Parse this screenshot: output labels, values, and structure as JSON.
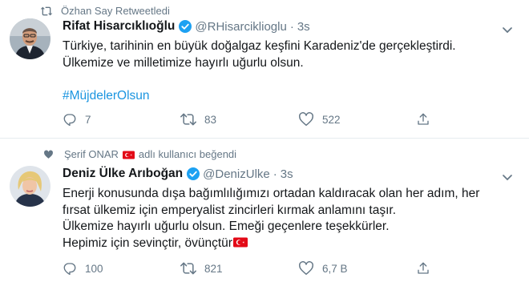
{
  "tweets": [
    {
      "social_context": "Özhan Say Retweetledi",
      "display_name": "Rifat Hisarcıklıoğlu",
      "handle": "@RHisarciklioglu",
      "separator": "·",
      "time": "3s",
      "text_lines": [
        "Türkiye, tarihinin en büyük doğalgaz keşfini Karadeniz'de gerçekleştirdi.",
        "Ülkemize ve milletimize hayırlı uğurlu olsun."
      ],
      "hashtag": "#MüjdelerOlsun",
      "reply_count": "7",
      "retweet_count": "83",
      "like_count": "522"
    },
    {
      "social_context_name": "Şerif ONAR",
      "social_context_suffix": "adlı kullanıcı beğendi",
      "display_name": "Deniz Ülke Arıboğan",
      "handle": "@DenizUlke",
      "separator": "·",
      "time": "3s",
      "text_lines": [
        "Enerji konusunda dışa  bağımlılığımızı ortadan kaldıracak olan her adım, her",
        "fırsat ülkemiz için emperyalist zincirleri kırmak anlamını taşır.",
        "Ülkemize hayırlı uğurlu olsun. Emeği geçenlere teşekkürler.",
        "Hepimiz için sevinçtir, övünçtür"
      ],
      "reply_count": "100",
      "retweet_count": "821",
      "like_count": "6,7 B"
    }
  ],
  "colors": {
    "text": "#14171a",
    "secondary": "#657786",
    "link": "#1b95e0",
    "verified": "#1da1f2",
    "flag_red": "#e30a17"
  }
}
